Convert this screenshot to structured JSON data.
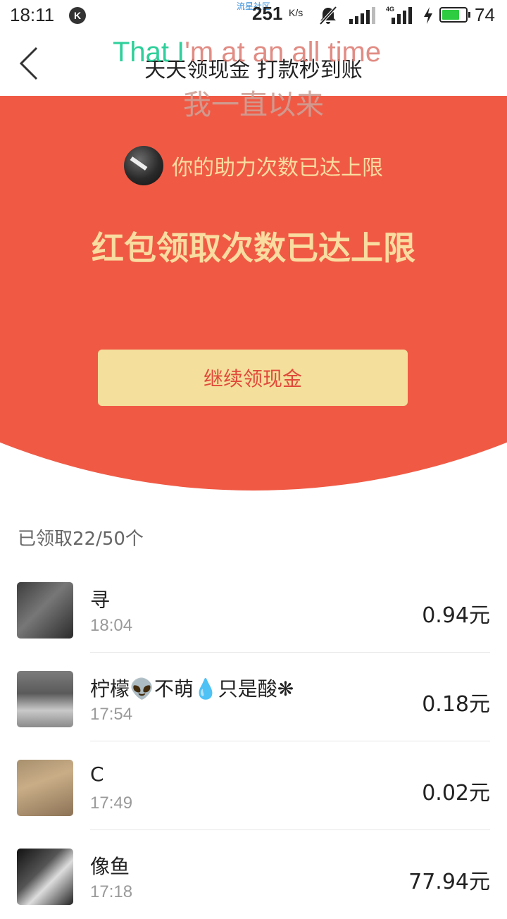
{
  "status_bar": {
    "time": "18:11",
    "k_badge": "K",
    "watermark": "流星社区",
    "speed": "251",
    "speed_unit": "K/s",
    "network": "4G",
    "battery_level": "74",
    "battery_fraction": 0.74,
    "battery_color": "#2ecc40"
  },
  "header": {
    "title": "天天领现金 打款秒到账",
    "back_icon": "chevron-left-icon"
  },
  "overlay": {
    "english_green": "That I",
    "english_rest": "'m at an all time",
    "chinese": "我一直以来"
  },
  "banner": {
    "assist_text": "你的助力次数已达上限",
    "limit_title": "红包领取次数已达上限",
    "continue_label": "继续领现金",
    "colors": {
      "background": "#f05a45",
      "text": "#f9dca0",
      "button": "#f4df9c",
      "button_text": "#e04a3a"
    }
  },
  "list": {
    "count_label": "已领取22/50个",
    "items": [
      {
        "name": "寻",
        "time": "18:04",
        "amount": "0.94元"
      },
      {
        "name": "柠檬👽不萌💧只是酸❋",
        "time": "17:54",
        "amount": "0.18元"
      },
      {
        "name": "C",
        "time": "17:49",
        "amount": "0.02元"
      },
      {
        "name": "像鱼",
        "time": "17:18",
        "amount": "77.94元"
      }
    ]
  }
}
